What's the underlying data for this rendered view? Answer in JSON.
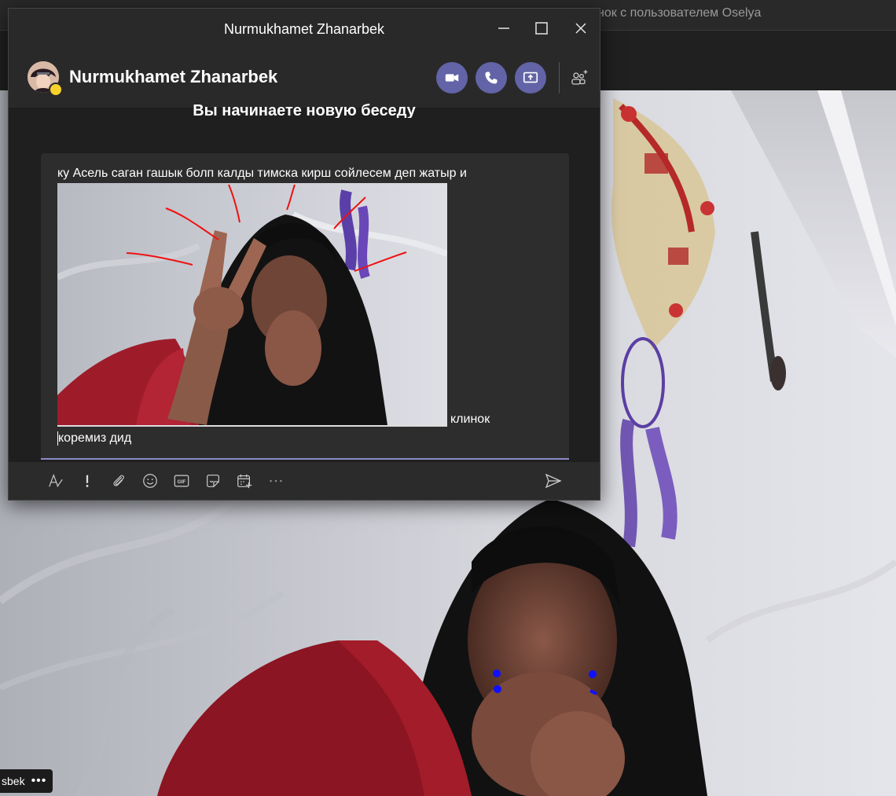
{
  "background_window": {
    "title": "нок с пользователем Oselya",
    "participant_name": "sbek",
    "more_label": "•••"
  },
  "chat_window": {
    "title": "Nurmukhamet Zhanarbek",
    "header_name": "Nurmukhamet Zhanarbek",
    "presence_color": "#f8d22a",
    "accent_color": "#6264a7",
    "new_conversation_text": "Вы начинаете новую беседу",
    "message": {
      "line1": "ку Асель саган гашык болп калды тимска кирш сойлесем деп жатыр и",
      "after_image": "клинок",
      "line3": "коремиз дид"
    },
    "toolbar_icons": [
      "format-icon",
      "important-icon",
      "attach-icon",
      "emoji-icon",
      "gif-icon",
      "sticker-icon",
      "schedule-meeting-icon",
      "more-icon",
      "send-icon"
    ],
    "gif_label": "GIF"
  }
}
